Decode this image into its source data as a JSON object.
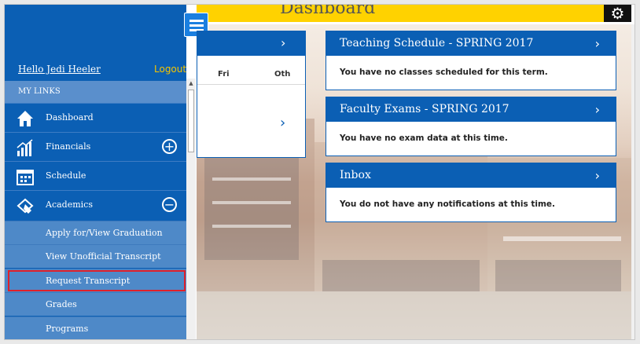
{
  "header": {
    "title": "Dashboard"
  },
  "sidebar": {
    "greeting": "Hello Jedi Heeler",
    "logout": "Logout",
    "section_title": "MY LINKS",
    "items": [
      {
        "label": "Dashboard",
        "icon": "home-icon"
      },
      {
        "label": "Financials",
        "icon": "financials-chart-icon",
        "toggle": "+"
      },
      {
        "label": "Schedule",
        "icon": "calendar-icon"
      },
      {
        "label": "Academics",
        "icon": "academics-icon",
        "toggle": "−"
      }
    ],
    "subitems": [
      {
        "label": "Apply for/View Graduation"
      },
      {
        "label": "View Unofficial Transcript"
      },
      {
        "label": "Request Transcript"
      },
      {
        "label": "Grades"
      },
      {
        "label": "Programs"
      }
    ]
  },
  "calendar_card": {
    "chevron": "›",
    "days": [
      "Fri",
      "Oth"
    ],
    "next": "›"
  },
  "cards": [
    {
      "title": "Teaching Schedule - SPRING 2017",
      "chevron": "›",
      "body": "You have no classes scheduled for this term."
    },
    {
      "title": "Faculty Exams - SPRING 2017",
      "chevron": "›",
      "body": "You have no exam data at this time."
    },
    {
      "title": "Inbox",
      "chevron": "›",
      "body": "You do not have any notifications at this time."
    }
  ],
  "colors": {
    "primary": "#0b5fb4",
    "accent": "#ffd200",
    "highlight": "#e0202a",
    "logout": "#f5c400"
  }
}
